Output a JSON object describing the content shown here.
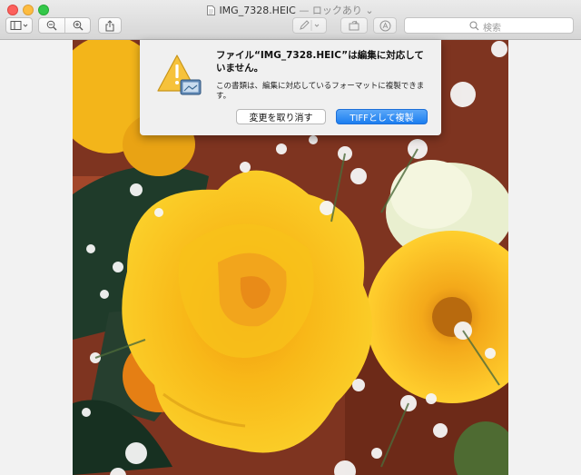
{
  "window": {
    "filename": "IMG_7328.HEIC",
    "title_suffix": " — ロックあり ⌄"
  },
  "toolbar": {
    "search_placeholder": "検索",
    "items": [
      "sidebar-toggle",
      "zoom-out",
      "zoom-in",
      "share",
      "markup",
      "rotate",
      "annotate"
    ]
  },
  "dialog": {
    "title": "ファイル“IMG_7328.HEIC”は編集に対応していません。",
    "message": "この書類は、編集に対応しているフォーマットに複製できます。",
    "cancel_label": "変更を取り消す",
    "default_label": "TIFFとして複製"
  },
  "colors": {
    "accent": "#1c7ef0",
    "photo_background": "#8a3a22",
    "rose": "#f8c21a"
  }
}
